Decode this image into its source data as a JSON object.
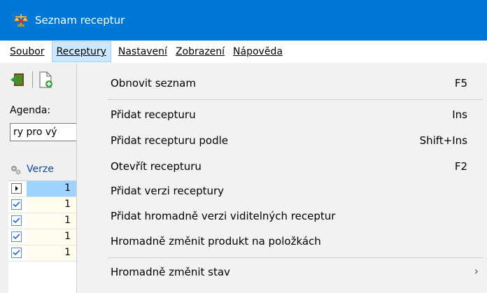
{
  "window": {
    "title": "Seznam receptur"
  },
  "menubar": {
    "items": [
      {
        "label": "Soubor",
        "active": false
      },
      {
        "label": "Receptury",
        "active": true
      },
      {
        "label": "Nastavení",
        "active": false
      },
      {
        "label": "Zobrazení",
        "active": false
      },
      {
        "label": "Nápověda",
        "active": false
      }
    ]
  },
  "left": {
    "agenda_label": "Agenda:",
    "agenda_value": "ry pro vý",
    "grid": {
      "column_header": "Verze",
      "rows": [
        {
          "value": "1",
          "checked": false,
          "current": true
        },
        {
          "value": "1",
          "checked": true,
          "current": false
        },
        {
          "value": "1",
          "checked": true,
          "current": false
        },
        {
          "value": "1",
          "checked": true,
          "current": false
        },
        {
          "value": "1",
          "checked": true,
          "current": false
        }
      ]
    }
  },
  "dropdown": {
    "items": [
      {
        "label": "Obnovit seznam",
        "shortcut": "F5"
      },
      {
        "label": "Přidat recepturu",
        "shortcut": "Ins"
      },
      {
        "label": "Přidat recepturu podle",
        "shortcut": "Shift+Ins"
      },
      {
        "label": "Otevřít recepturu",
        "shortcut": "F2"
      },
      {
        "label": "Přidat verzi receptury",
        "shortcut": ""
      },
      {
        "label": "Přidat hromadně verzi viditelných receptur",
        "shortcut": ""
      },
      {
        "label": "Hromadně změnit produkt na položkách",
        "shortcut": ""
      },
      {
        "label": "Hromadně změnit stav",
        "shortcut": "",
        "submenu_arrow": "›"
      }
    ]
  },
  "colors": {
    "titlebar": "#0078d7",
    "menu_active": "#cce8ff",
    "selected_cell": "#9ed2ff"
  }
}
